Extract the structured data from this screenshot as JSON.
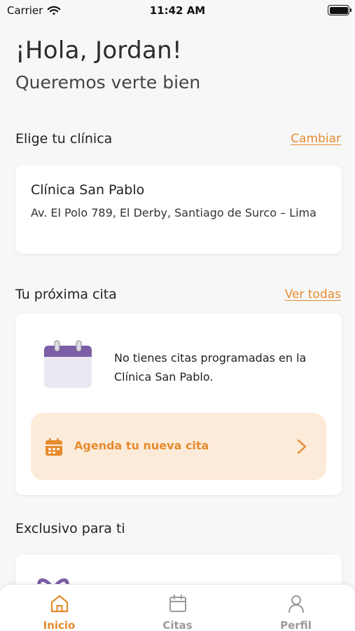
{
  "status_bar": {
    "carrier": "Carrier",
    "time": "11:42 AM"
  },
  "greeting": {
    "title": "¡Hola, Jordan!",
    "subtitle": "Queremos verte bien"
  },
  "clinic_section": {
    "title": "Elige tu clínica",
    "link": "Cambiar",
    "clinic_name": "Clínica San Pablo",
    "clinic_address": "Av. El Polo 789, El Derby, Santiago de Surco – Lima"
  },
  "appointment_section": {
    "title": "Tu próxima cita",
    "link": "Ver todas",
    "empty_message": "No tienes citas programadas en la Clínica San Pablo.",
    "cta_label": "Agenda tu nueva cita"
  },
  "exclusive_section": {
    "title": "Exclusivo para ti"
  },
  "tabbar": {
    "tabs": [
      {
        "label": "Inicio",
        "icon": "home-icon",
        "active": true
      },
      {
        "label": "Citas",
        "icon": "calendar-icon",
        "active": false
      },
      {
        "label": "Perfil",
        "icon": "user-icon",
        "active": false
      }
    ]
  },
  "colors": {
    "accent": "#e58b2f",
    "accent_soft": "#fdebd9",
    "purple": "#7b5ea7",
    "background": "#f7f7f7"
  }
}
